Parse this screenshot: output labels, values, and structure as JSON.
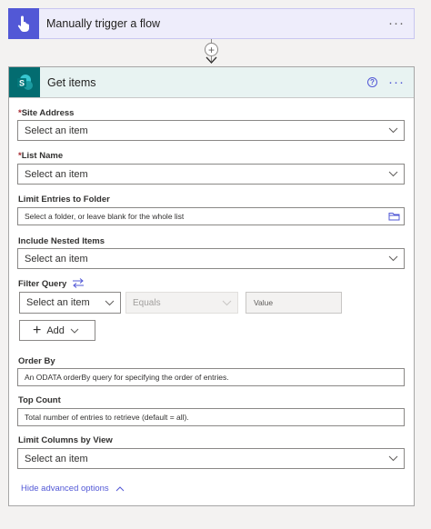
{
  "trigger": {
    "title": "Manually trigger a flow",
    "more": "···"
  },
  "connector": {
    "plus": "+"
  },
  "action": {
    "title": "Get items",
    "help": "?",
    "more": "···",
    "fields": {
      "site_address": {
        "required": "*",
        "label": "Site Address",
        "value": "Select an item"
      },
      "list_name": {
        "required": "*",
        "label": "List Name",
        "value": "Select an item"
      },
      "limit_folder": {
        "label": "Limit Entries to Folder",
        "placeholder": "Select a folder, or leave blank for the whole list"
      },
      "nested_items": {
        "label": "Include Nested Items",
        "value": "Select an item"
      },
      "filter_query": {
        "label": "Filter Query",
        "field": "Select an item",
        "operator": "Equals",
        "value_placeholder": "Value",
        "add_label": "Add"
      },
      "order_by": {
        "label": "Order By",
        "placeholder": "An ODATA orderBy query for specifying the order of entries."
      },
      "top_count": {
        "label": "Top Count",
        "placeholder": "Total number of entries to retrieve (default = all)."
      },
      "limit_columns": {
        "label": "Limit Columns by View",
        "value": "Select an item"
      }
    },
    "hide_advanced": "Hide advanced options"
  },
  "colors": {
    "accent": "#5258d6",
    "sharepoint": "#036c70",
    "required": "#a4262c"
  }
}
